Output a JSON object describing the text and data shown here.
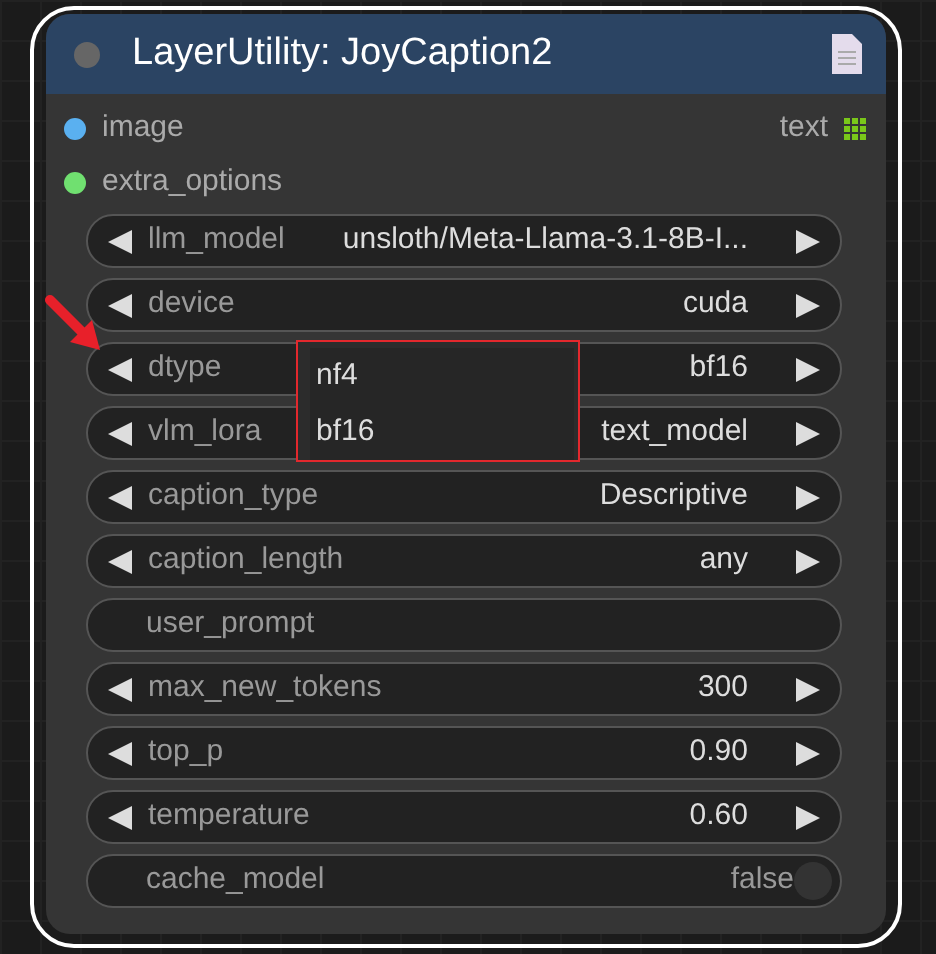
{
  "node": {
    "title": "LayerUtility: JoyCaption2",
    "inputs": [
      {
        "label": "image",
        "color": "#5ab0f0"
      },
      {
        "label": "extra_options",
        "color": "#70e070"
      }
    ],
    "outputs": [
      {
        "label": "text",
        "color": "#7ac61a"
      }
    ],
    "widgets": [
      {
        "kind": "combo",
        "label": "llm_model",
        "value": "unsloth/Meta-Llama-3.1-8B-I..."
      },
      {
        "kind": "combo",
        "label": "device",
        "value": "cuda"
      },
      {
        "kind": "combo",
        "label": "dtype",
        "value": "bf16"
      },
      {
        "kind": "combo",
        "label": "vlm_lora",
        "value": "text_model"
      },
      {
        "kind": "combo",
        "label": "caption_type",
        "value": "Descriptive"
      },
      {
        "kind": "combo",
        "label": "caption_length",
        "value": "any"
      },
      {
        "kind": "text",
        "label": "user_prompt"
      },
      {
        "kind": "number",
        "label": "max_new_tokens",
        "value": "300"
      },
      {
        "kind": "number",
        "label": "top_p",
        "value": "0.90"
      },
      {
        "kind": "number",
        "label": "temperature",
        "value": "0.60"
      },
      {
        "kind": "toggle",
        "label": "cache_model",
        "value": "false",
        "on": false
      }
    ]
  },
  "dropdown": {
    "items": [
      {
        "label": "nf4"
      },
      {
        "label": "bf16"
      }
    ]
  }
}
